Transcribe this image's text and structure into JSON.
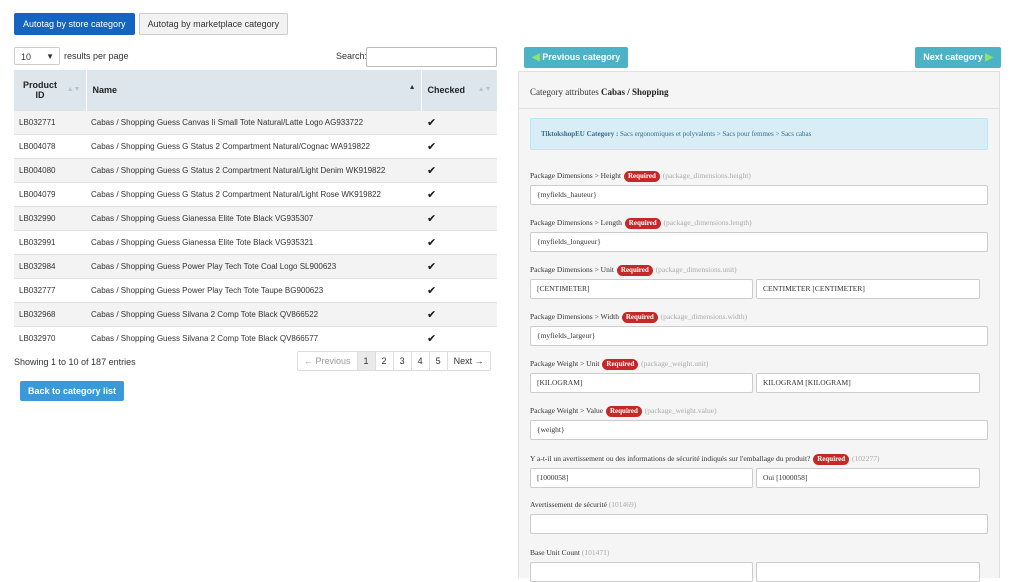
{
  "tabs": [
    "Autotag by store category",
    "Autotag by marketplace category"
  ],
  "table_controls": {
    "length_value": "10",
    "length_label": "results per page",
    "search_label": "Search:"
  },
  "table": {
    "headers": [
      "Product ID",
      "Name",
      "Checked"
    ],
    "rows": [
      {
        "id": "LB032771",
        "name": "Cabas / Shopping Guess Canvas Ii Small Tote Natural/Latte Logo AG933722",
        "checked": "✔"
      },
      {
        "id": "LB004078",
        "name": "Cabas / Shopping Guess G Status 2 Compartment Natural/Cognac WA919822",
        "checked": "✔"
      },
      {
        "id": "LB004080",
        "name": "Cabas / Shopping Guess G Status 2 Compartment Natural/Light Denim WK919822",
        "checked": "✔"
      },
      {
        "id": "LB004079",
        "name": "Cabas / Shopping Guess G Status 2 Compartment Natural/Light Rose WK919822",
        "checked": "✔"
      },
      {
        "id": "LB032990",
        "name": "Cabas / Shopping Guess Gianessa Elite Tote Black VG935307",
        "checked": "✔"
      },
      {
        "id": "LB032991",
        "name": "Cabas / Shopping Guess Gianessa Elite Tote Black VG935321",
        "checked": "✔"
      },
      {
        "id": "LB032984",
        "name": "Cabas / Shopping Guess Power Play Tech Tote Coal Logo SL900623",
        "checked": "✔"
      },
      {
        "id": "LB032777",
        "name": "Cabas / Shopping Guess Power Play Tech Tote Taupe BG900623",
        "checked": "✔"
      },
      {
        "id": "LB032968",
        "name": "Cabas / Shopping Guess Silvana 2 Comp Tote Black QV866522",
        "checked": "✔"
      },
      {
        "id": "LB032970",
        "name": "Cabas / Shopping Guess Silvana 2 Comp Tote Black QV866577",
        "checked": "✔"
      }
    ]
  },
  "info_text": "Showing 1 to 10 of 187 entries",
  "pagination": {
    "previous": "← Previous",
    "pages": [
      "1",
      "2",
      "3",
      "4",
      "5"
    ],
    "next": "Next →"
  },
  "back_button": "Back to category list",
  "prev_category": "Previous category",
  "next_category": "Next category",
  "panel": {
    "title_prefix": "Category attributes",
    "title_category": "Cabas / Shopping",
    "notice_label": "TiktokshopEU Category :",
    "notice_path": "Sacs ergonomiques et polyvalents > Sacs pour femmes > Sacs cabas",
    "required_label": "Required",
    "attributes": [
      {
        "label": "Package Dimensions > Height",
        "required": true,
        "code": "(package_dimensions.height)",
        "values": [
          "{myfields_hauteur}"
        ]
      },
      {
        "label": "Package Dimensions > Length",
        "required": true,
        "code": "(package_dimensions.length)",
        "values": [
          "{myfields_longueur}"
        ]
      },
      {
        "label": "Package Dimensions > Unit",
        "required": true,
        "code": "(package_dimensions.unit)",
        "values": [
          "[CENTIMETER]",
          "CENTIMETER [CENTIMETER]"
        ]
      },
      {
        "label": "Package Dimensions > Width",
        "required": true,
        "code": "(package_dimensions.width)",
        "values": [
          "{myfields_largeur}"
        ]
      },
      {
        "label": "Package Weight > Unit",
        "required": true,
        "code": "(package_weight.unit)",
        "values": [
          "[KILOGRAM]",
          "KILOGRAM [KILOGRAM]"
        ]
      },
      {
        "label": "Package Weight > Value",
        "required": true,
        "code": "(package_weight.value)",
        "values": [
          "{weight}"
        ]
      },
      {
        "label": "Y a-t-il un avertissement ou des informations de sécurité indiqués sur l'emballage du produit?",
        "required": true,
        "code": "(102277)",
        "values": [
          "[1000058]",
          "Oui [1000058]"
        ]
      },
      {
        "label": "Avertissement de sécurité",
        "required": false,
        "code": "(101469)",
        "values": [
          ""
        ]
      },
      {
        "label": "Base Unit Count",
        "required": false,
        "code": "(101471)",
        "values": [
          "",
          ""
        ]
      }
    ]
  }
}
